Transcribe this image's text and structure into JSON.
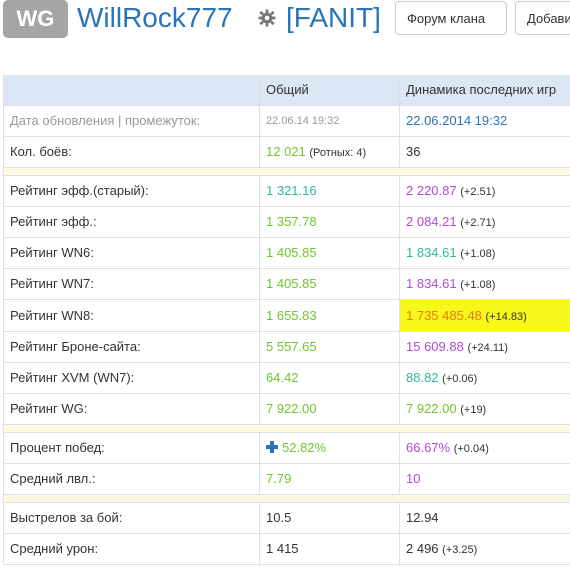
{
  "header": {
    "badge": "WG",
    "player_name": "WillRock777",
    "clan_tag": "[FANIT]",
    "forum_button": "Форум клана",
    "add_button": "Добави"
  },
  "columns": {
    "col1": "",
    "col2": "Общий",
    "col3": "Динамика последних игр"
  },
  "rows": {
    "updated": {
      "label": "Дата обновления | промежуток:",
      "total": "22.06.14 19:32",
      "recent": "22.06.2014 19:32"
    },
    "battles": {
      "label": "Кол. боёв:",
      "total": "12 021",
      "total_note": "(Ротных: 4)",
      "recent": "36"
    },
    "eff_old": {
      "label": "Рейтинг эфф.(старый):",
      "total": "1 321.16",
      "recent": "2 220.87",
      "recent_delta": "(+2.51)"
    },
    "eff": {
      "label": "Рейтинг эфф.:",
      "total": "1 357.78",
      "recent": "2 084.21",
      "recent_delta": "(+2.71)"
    },
    "wn6": {
      "label": "Рейтинг WN6:",
      "total": "1 405.85",
      "recent": "1 834.61",
      "recent_delta": "(+1.08)"
    },
    "wn7": {
      "label": "Рейтинг WN7:",
      "total": "1 405.85",
      "recent": "1 834.61",
      "recent_delta": "(+1.08)"
    },
    "wn8": {
      "label": "Рейтинг WN8:",
      "total": "1 655.83",
      "recent": "1 735 485.48",
      "recent_delta": "(+14.83)"
    },
    "armor": {
      "label": "Рейтинг Броне-сайта:",
      "total": "5 557.65",
      "recent": "15 609.88",
      "recent_delta": "(+24.11)"
    },
    "xvm": {
      "label": "Рейтинг XVM (WN7):",
      "total": "64.42",
      "recent": "88.82",
      "recent_delta": "(+0.06)"
    },
    "wg": {
      "label": "Рейтинг WG:",
      "total": "7 922.00",
      "recent": "7 922.00",
      "recent_delta": "(+19)"
    },
    "winrate": {
      "label": "Процент побед:",
      "total": "52.82%",
      "recent": "66.67%",
      "recent_delta": "(+0.04)"
    },
    "avg_level": {
      "label": "Средний лвл.:",
      "total": "7.79",
      "recent": "10"
    },
    "shots": {
      "label": "Выстрелов за бой:",
      "total": "10.5",
      "recent": "12.94"
    },
    "avg_damage": {
      "label": "Средний урон:",
      "total": "1 415",
      "recent": "2 496",
      "recent_delta": "(+3.25)"
    }
  },
  "colors": {
    "link_blue": "#2b74b9",
    "teal": "#2fb8a1",
    "green": "#6fc62a",
    "purple": "#b24ad5",
    "orange": "#e87b1a",
    "highlight": "#f7f719",
    "header_row": "#dbe7f4",
    "separator_row": "#fdf8e4"
  },
  "icons": {
    "clan_emblem": "gear-icon",
    "winrate_marker": "plus-icon"
  }
}
